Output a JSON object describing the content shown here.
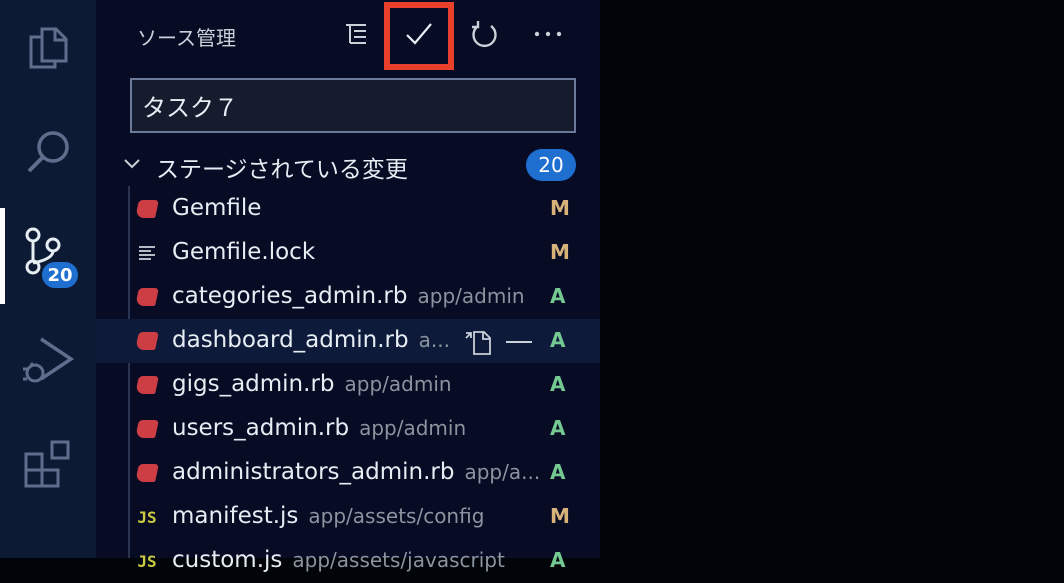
{
  "activity_bar": {
    "items": [
      {
        "name": "explorer",
        "icon": "files-icon"
      },
      {
        "name": "search",
        "icon": "search-icon"
      },
      {
        "name": "source-control",
        "icon": "source-control-icon",
        "badge": "20",
        "active": true
      },
      {
        "name": "run-debug",
        "icon": "run-debug-icon"
      },
      {
        "name": "extensions",
        "icon": "extensions-icon"
      }
    ]
  },
  "sidebar": {
    "title": "ソース管理",
    "actions": [
      "view-as-tree-icon",
      "commit-check-icon",
      "refresh-icon",
      "more-actions-icon"
    ],
    "commit_message": "タスク７",
    "group": {
      "label": "ステージされている変更",
      "count": "20"
    },
    "files": [
      {
        "name": "Gemfile",
        "path": "",
        "status": "M",
        "icon": "ruby"
      },
      {
        "name": "Gemfile.lock",
        "path": "",
        "status": "M",
        "icon": "lines"
      },
      {
        "name": "categories_admin.rb",
        "path": "app/admin",
        "status": "A",
        "icon": "ruby"
      },
      {
        "name": "dashboard_admin.rb",
        "path": "a...",
        "status": "A",
        "icon": "ruby",
        "hover": true
      },
      {
        "name": "gigs_admin.rb",
        "path": "app/admin",
        "status": "A",
        "icon": "ruby"
      },
      {
        "name": "users_admin.rb",
        "path": "app/admin",
        "status": "A",
        "icon": "ruby"
      },
      {
        "name": "administrators_admin.rb",
        "path": "app/a...",
        "status": "A",
        "icon": "ruby"
      },
      {
        "name": "manifest.js",
        "path": "app/assets/config",
        "status": "M",
        "icon": "js"
      },
      {
        "name": "custom.js",
        "path": "app/assets/javascript",
        "status": "A",
        "icon": "js"
      }
    ]
  },
  "colors": {
    "highlight": "#e8412b",
    "badge": "#1f6fd1",
    "modified": "#d7b279",
    "added": "#73c991"
  }
}
